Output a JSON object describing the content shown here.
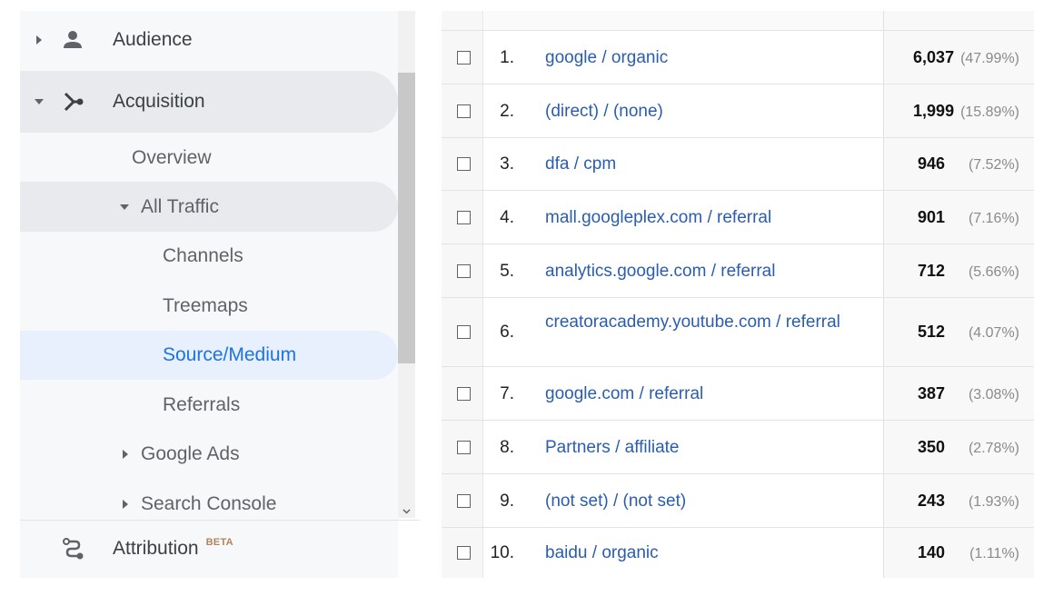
{
  "sidebar": {
    "audience": {
      "label": "Audience",
      "icon": "person-icon"
    },
    "acquisition": {
      "label": "Acquisition",
      "icon": "acquisition-icon"
    },
    "overview": {
      "label": "Overview"
    },
    "all_traffic": {
      "label": "All Traffic"
    },
    "channels": {
      "label": "Channels"
    },
    "treemaps": {
      "label": "Treemaps"
    },
    "source_medium": {
      "label": "Source/Medium"
    },
    "referrals": {
      "label": "Referrals"
    },
    "google_ads": {
      "label": "Google Ads"
    },
    "search_console": {
      "label": "Search Console"
    },
    "attribution": {
      "label": "Attribution",
      "badge": "BETA",
      "icon": "attribution-icon"
    }
  },
  "colors": {
    "link": "#2a5db0",
    "active_nav": "#1a73e8",
    "active_nav_bg": "#e8f0fe",
    "beta": "#b5835a"
  },
  "table": {
    "rows": [
      {
        "num": "1.",
        "source": "google / organic",
        "value": "6,037",
        "pct": "(47.99%)"
      },
      {
        "num": "2.",
        "source": "(direct) / (none)",
        "value": "1,999",
        "pct": "(15.89%)"
      },
      {
        "num": "3.",
        "source": "dfa / cpm",
        "value": "946",
        "pct": "(7.52%)"
      },
      {
        "num": "4.",
        "source": "mall.googleplex.com / referral",
        "value": "901",
        "pct": "(7.16%)"
      },
      {
        "num": "5.",
        "source": "analytics.google.com / referral",
        "value": "712",
        "pct": "(5.66%)"
      },
      {
        "num": "6.",
        "source": "creatoracademy.youtube.com / referral",
        "value": "512",
        "pct": "(4.07%)"
      },
      {
        "num": "7.",
        "source": "google.com / referral",
        "value": "387",
        "pct": "(3.08%)"
      },
      {
        "num": "8.",
        "source": "Partners / affiliate",
        "value": "350",
        "pct": "(2.78%)"
      },
      {
        "num": "9.",
        "source": "(not set) / (not set)",
        "value": "243",
        "pct": "(1.93%)"
      },
      {
        "num": "10.",
        "source": "baidu / organic",
        "value": "140",
        "pct": "(1.11%)"
      }
    ]
  }
}
